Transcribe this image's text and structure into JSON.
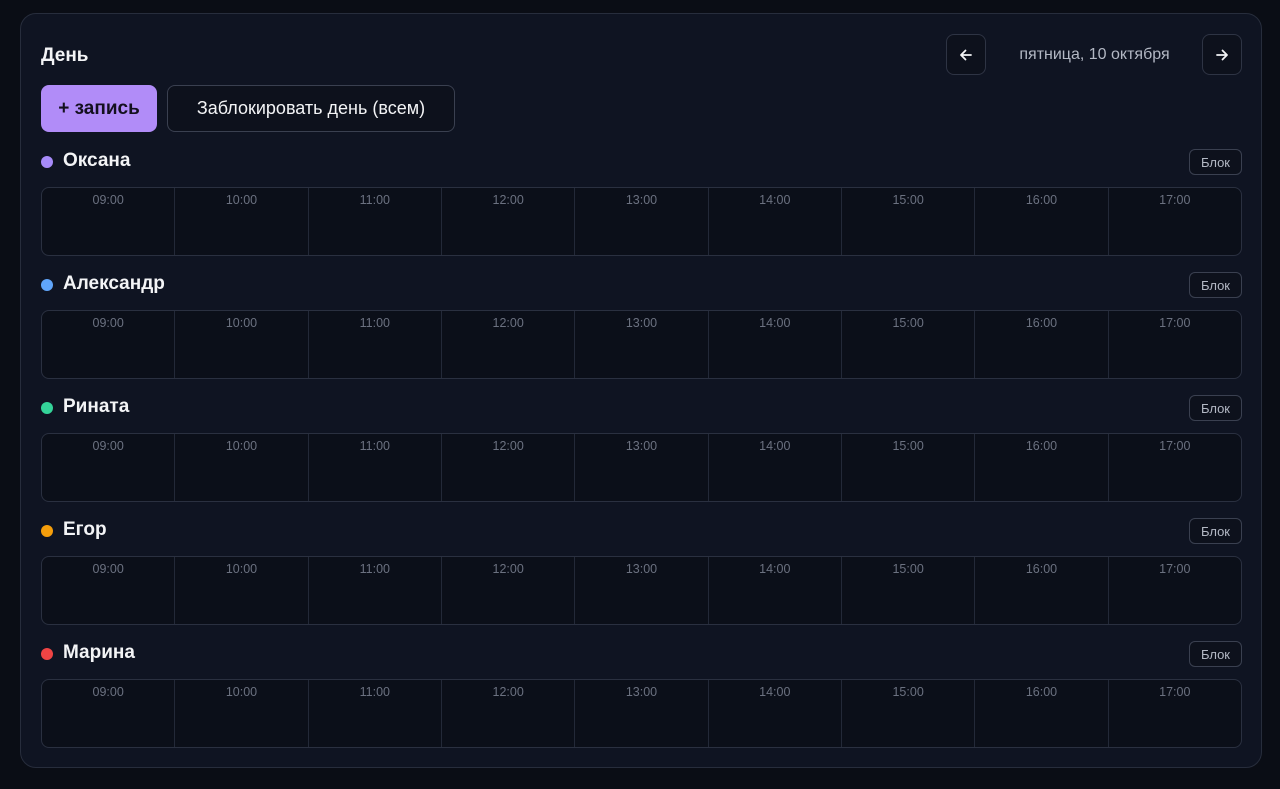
{
  "header": {
    "title": "День",
    "date": "пятница, 10 октября"
  },
  "actions": {
    "add_label": "+ запись",
    "block_day_label": "Заблокировать день (всем)"
  },
  "block_label": "Блок",
  "hours": [
    "09:00",
    "10:00",
    "11:00",
    "12:00",
    "13:00",
    "14:00",
    "15:00",
    "16:00",
    "17:00"
  ],
  "staff": [
    {
      "name": "Оксана",
      "color": "#a78bfa"
    },
    {
      "name": "Александр",
      "color": "#60a5fa"
    },
    {
      "name": "Рината",
      "color": "#34d399"
    },
    {
      "name": "Егор",
      "color": "#f59e0b"
    },
    {
      "name": "Марина",
      "color": "#ef4444"
    }
  ],
  "icons": {
    "prev": "arrow-left-icon",
    "next": "arrow-right-icon"
  }
}
